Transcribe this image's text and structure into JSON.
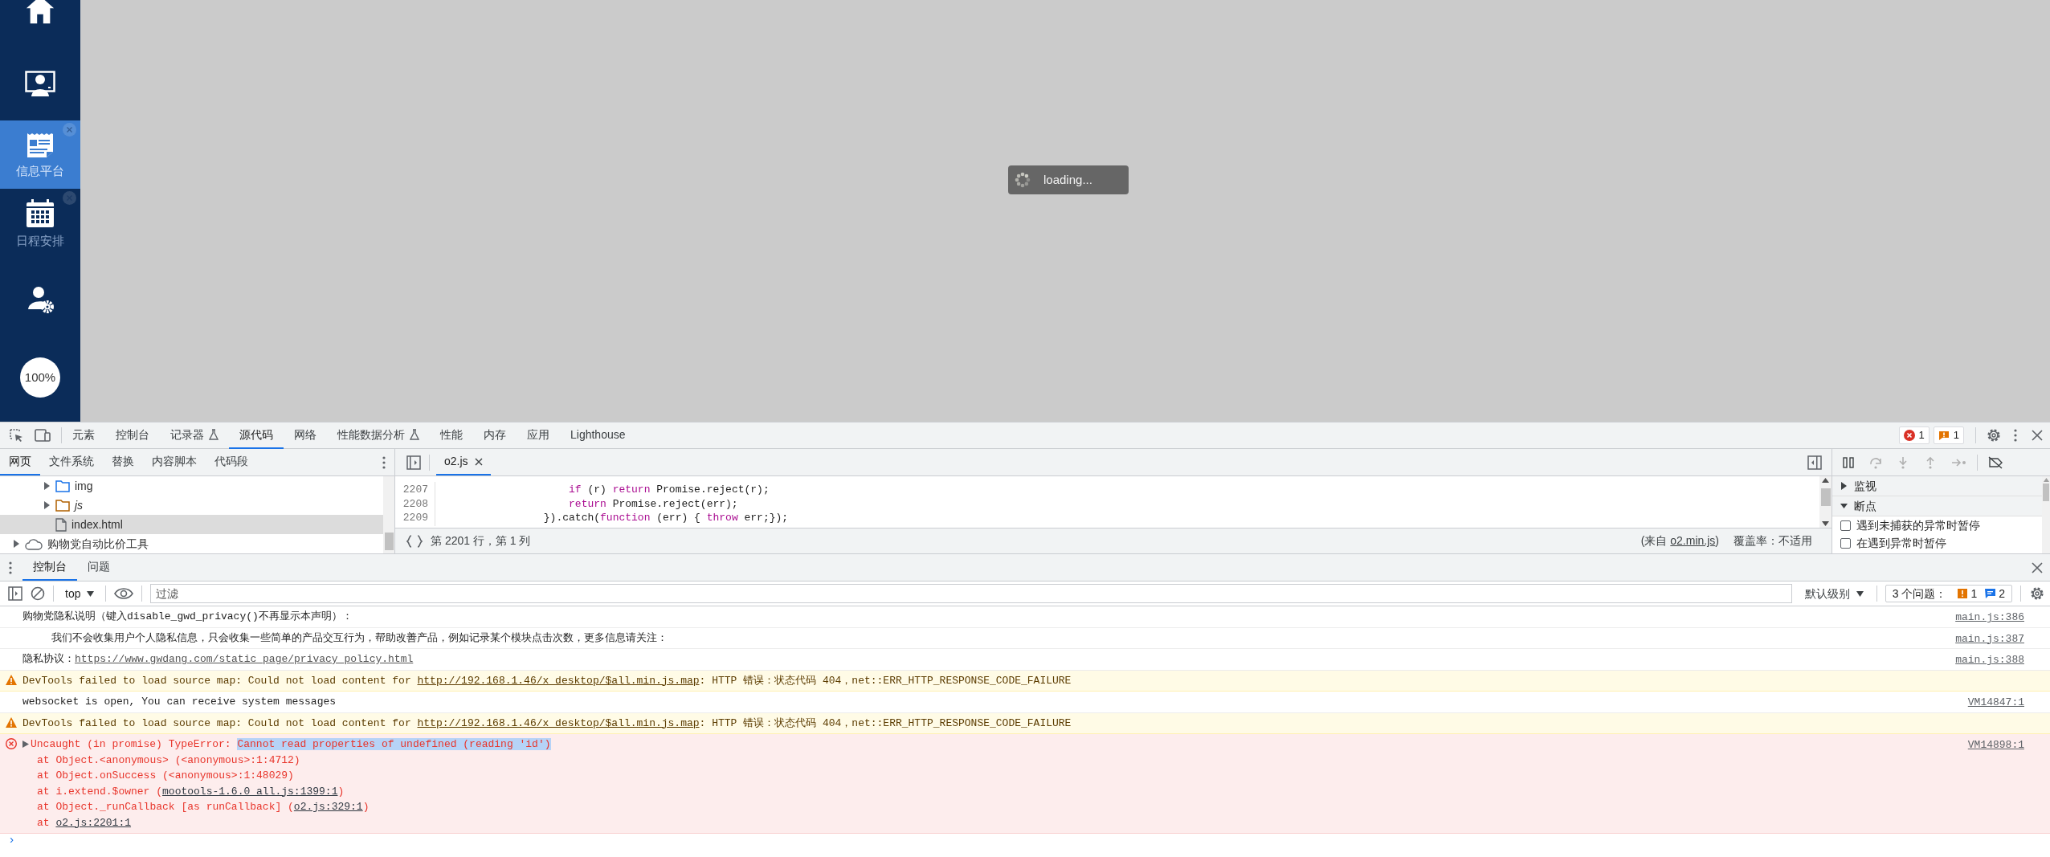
{
  "sidebar": {
    "items": [
      {
        "kind": "home",
        "selected": false,
        "closable": false
      },
      {
        "kind": "monitor",
        "selected": false,
        "closable": false
      },
      {
        "kind": "news",
        "label": "信息平台",
        "selected": true,
        "closable": true
      },
      {
        "kind": "calendar",
        "label": "日程安排",
        "selected": false,
        "closable": true
      },
      {
        "kind": "user-settings",
        "selected": false,
        "closable": false
      }
    ],
    "zoom": "100%"
  },
  "loading": "loading...",
  "devtools": {
    "tabs": [
      {
        "label": "元素",
        "experimental": false,
        "selected": false
      },
      {
        "label": "控制台",
        "experimental": false,
        "selected": false
      },
      {
        "label": "记录器",
        "experimental": true,
        "selected": false
      },
      {
        "label": "源代码",
        "experimental": false,
        "selected": true
      },
      {
        "label": "网络",
        "experimental": false,
        "selected": false
      },
      {
        "label": "性能数据分析",
        "experimental": true,
        "selected": false
      },
      {
        "label": "性能",
        "experimental": false,
        "selected": false
      },
      {
        "label": "内存",
        "experimental": false,
        "selected": false
      },
      {
        "label": "应用",
        "experimental": false,
        "selected": false
      },
      {
        "label": "Lighthouse",
        "experimental": false,
        "selected": false
      }
    ],
    "error_count": "1",
    "warning_count": "1",
    "sources": {
      "navigator_tabs": [
        {
          "label": "网页",
          "selected": true
        },
        {
          "label": "文件系统",
          "selected": false
        },
        {
          "label": "替换",
          "selected": false
        },
        {
          "label": "内容脚本",
          "selected": false
        },
        {
          "label": "代码段",
          "selected": false
        }
      ],
      "tree": [
        {
          "children": [
            {
              "kind": "image-folder",
              "label": "img",
              "expanded": false,
              "selected": false
            },
            {
              "kind": "folder",
              "label": "js",
              "expanded": false,
              "selected": false
            },
            {
              "kind": "file",
              "label": "index.html",
              "selected": true
            }
          ]
        },
        {
          "kind": "cloud",
          "label": "购物党自动比价工具",
          "expanded": false,
          "selected": false
        }
      ],
      "editor_tab": "o2.js",
      "code_lines": [
        {
          "number": "2207",
          "tokens": [
            {
              "kind": "keyword",
              "text": "                    if"
            },
            {
              "kind": "plain",
              "text": " (r) "
            },
            {
              "kind": "keyword",
              "text": "return"
            },
            {
              "kind": "plain",
              "text": " Promise.reject(r);"
            }
          ]
        },
        {
          "number": "2208",
          "tokens": [
            {
              "kind": "keyword",
              "text": "                    return"
            },
            {
              "kind": "plain",
              "text": " Promise.reject(err);"
            }
          ]
        },
        {
          "number": "2209",
          "tokens": [
            {
              "kind": "plain",
              "text": "                }).catch("
            },
            {
              "kind": "keyword",
              "text": "function"
            },
            {
              "kind": "plain",
              "text": " (err) { "
            },
            {
              "kind": "keyword",
              "text": "throw"
            },
            {
              "kind": "plain",
              "text": " err;});"
            }
          ]
        }
      ],
      "status": {
        "position": "第 2201 行，第 1 列",
        "source_prefix": "(来自",
        "source_link": "o2.min.js",
        "source_suffix": ")",
        "coverage": "覆盖率：不适用"
      },
      "debugger": {
        "sections": [
          {
            "label": "监视",
            "expanded": false
          },
          {
            "label": "断点",
            "expanded": true
          }
        ],
        "options": [
          {
            "label": "遇到未捕获的异常时暂停",
            "checked": false
          },
          {
            "label": "在遇到异常时暂停",
            "checked": false
          }
        ]
      }
    },
    "drawer": {
      "tabs": [
        {
          "label": "控制台",
          "selected": true
        },
        {
          "label": "问题",
          "selected": false
        }
      ],
      "context": "top",
      "filter_placeholder": "过滤",
      "level": "默认级别",
      "issues": {
        "label": "3 个问题：",
        "warnings": "1",
        "infos": "2"
      },
      "messages": [
        {
          "kind": "log",
          "indented": false,
          "text": "购物党隐私说明（键入disable_gwd_privacy()不再显示本声明）：",
          "source": "main.js:386"
        },
        {
          "kind": "log",
          "indented": true,
          "text": "我们不会收集用户个人隐私信息，只会收集一些简单的产品交互行为，帮助改善产品，例如记录某个模块点击次数，更多信息请关注：",
          "source": "main.js:387"
        },
        {
          "kind": "log",
          "indented": false,
          "text": "隐私协议：",
          "link": "https://www.gwdang.com/static_page/privacy_policy.html",
          "source": "main.js:388"
        },
        {
          "kind": "warning",
          "indented": false,
          "text": "DevTools failed to load source map: Could not load content for ",
          "link": "http://192.168.1.46/x_desktop/$all.min.js.map",
          "after": ": HTTP 错误：状态代码 404，net::ERR_HTTP_RESPONSE_CODE_FAILURE"
        },
        {
          "kind": "log",
          "indented": false,
          "text": "websocket is open, You can receive system messages",
          "source": "VM14847:1"
        },
        {
          "kind": "warning",
          "indented": false,
          "text": "DevTools failed to load source map: Could not load content for ",
          "link": "http://192.168.1.46/x_desktop/$all.min.js.map",
          "after": ": HTTP 错误：状态代码 404，net::ERR_HTTP_RESPONSE_CODE_FAILURE"
        },
        {
          "kind": "error",
          "indented": false,
          "expanded": false,
          "text": "Uncaught (in promise) TypeError: ",
          "highlight": "Cannot read properties of undefined (reading 'id')",
          "source": "VM14898:1",
          "stack": [
            {
              "text": "at Object.<anonymous> (<anonymous>:1:4712)"
            },
            {
              "text": "at Object.onSuccess (<anonymous>:1:48029)"
            },
            {
              "text": "at i.extend.$owner (",
              "link": "mootools-1.6.0_all.js:1399:1",
              "after": ")"
            },
            {
              "text": "at Object._runCallback [as runCallback] (",
              "link": "o2.js:329:1",
              "after": ")"
            },
            {
              "text": "at ",
              "link": "o2.js:2201:1"
            }
          ]
        }
      ],
      "prompt": "›"
    }
  }
}
